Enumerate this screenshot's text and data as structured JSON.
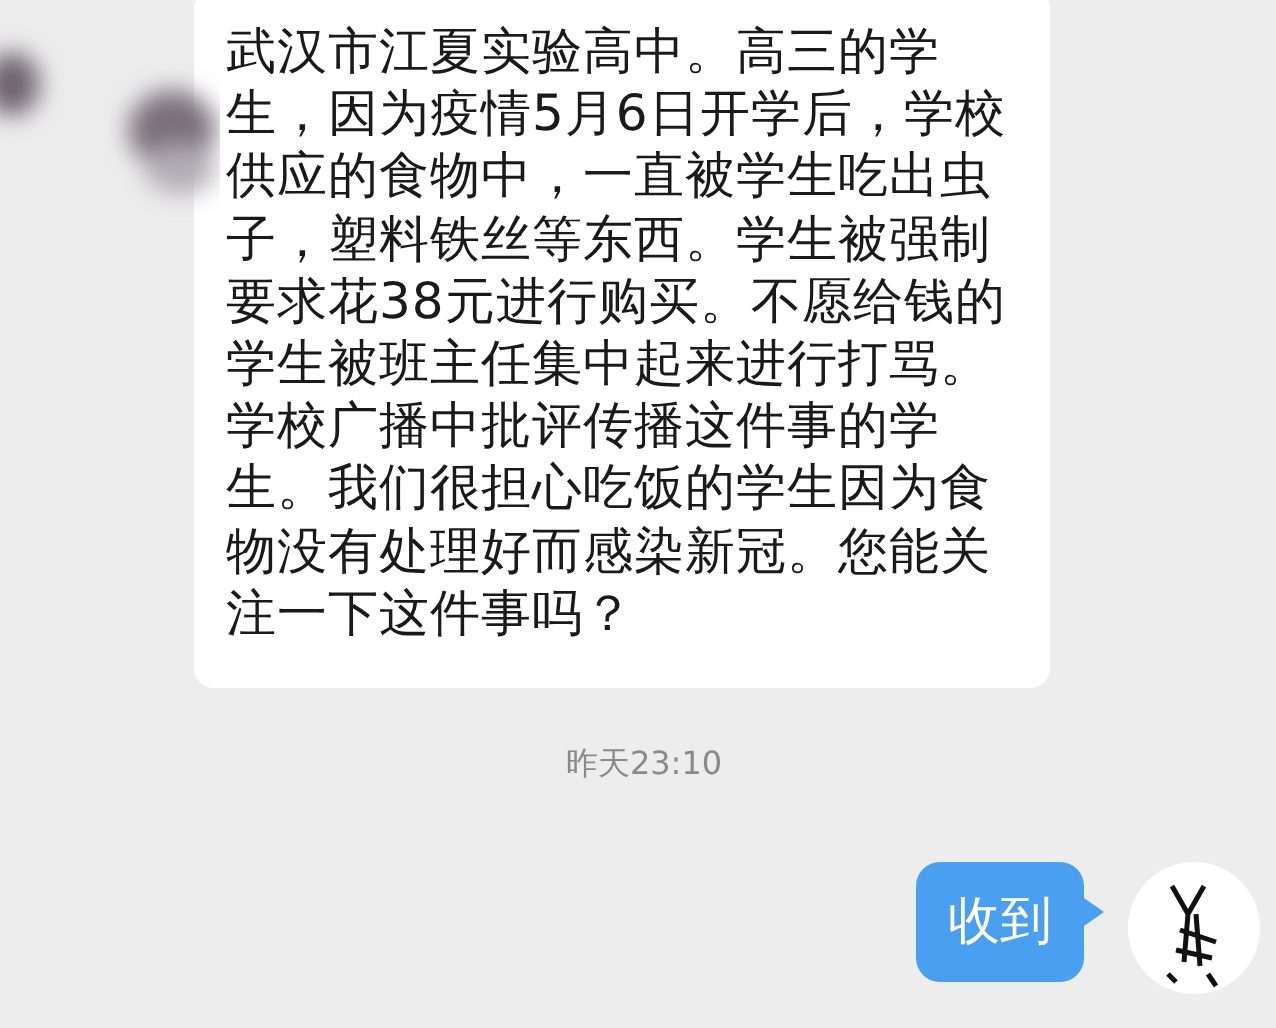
{
  "incoming_message": {
    "lines": [
      "武汉市江夏实验高中。高三的学",
      "生，因为疫情5月6日开学后，学校",
      "供应的食物中，一直被学生吃出虫",
      "子，塑料铁丝等东西。学生被强制",
      "要求花38元进行购买。不愿给钱的",
      "学生被班主任集中起来进行打骂。",
      "学校广播中批评传播这件事的学",
      "生。我们很担心吃饭的学生因为食",
      "物没有处理好而感染新冠。您能关",
      "注一下这件事吗？"
    ]
  },
  "timestamp": "昨天23:10",
  "outgoing_message": {
    "text": "收到"
  }
}
